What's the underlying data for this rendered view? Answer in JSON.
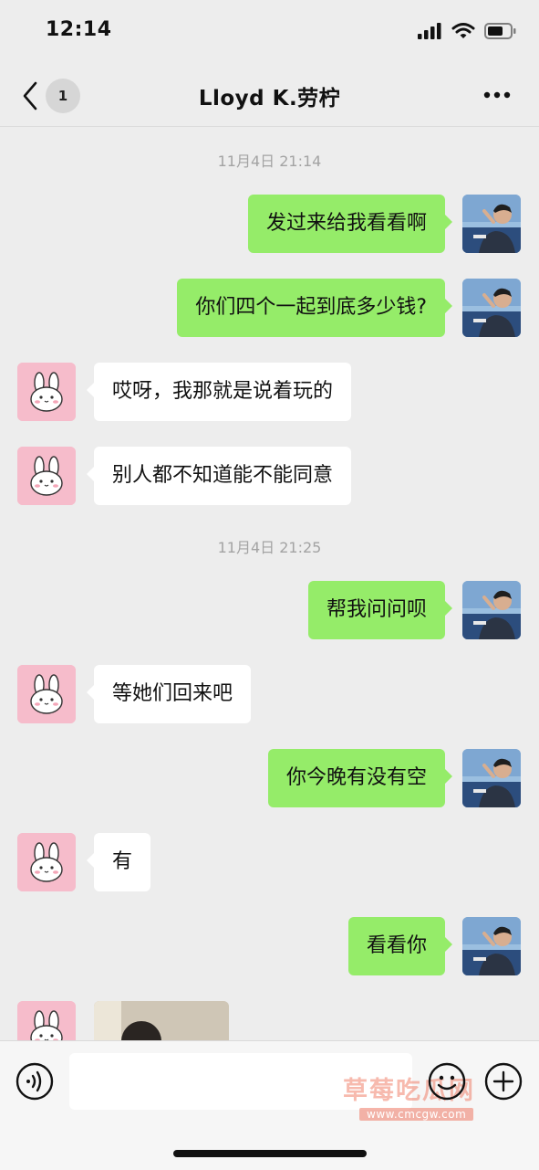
{
  "status_bar": {
    "time": "12:14"
  },
  "nav": {
    "back_badge": "1",
    "title": "Lloyd K.劳柠"
  },
  "colors": {
    "sent_bubble": "#95ec69",
    "recv_bubble": "#ffffff",
    "background": "#ededed"
  },
  "messages": {
    "ts1": "11月4日 21:14",
    "m1": "发过来给我看看啊",
    "m2": "你们四个一起到底多少钱?",
    "m3": "哎呀，我那就是说着玩的",
    "m4": "别人都不知道能不能同意",
    "ts2": "11月4日 21:25",
    "m5": "帮我问问呗",
    "m6": "等她们回来吧",
    "m7": "你今晚有没有空",
    "m8": "有",
    "m9": "看看你"
  },
  "input_bar": {
    "message_value": ""
  },
  "watermark": {
    "text": "草莓吃瓜网",
    "url": "www.cmcgw.com"
  },
  "icons": {
    "back": "chevron-left-icon",
    "more": "more-dots-icon",
    "voice": "voice-icon",
    "emoji": "emoji-icon",
    "plus": "plus-icon",
    "contact_avatar": "bunny-avatar",
    "self_avatar": "user-photo-avatar"
  }
}
